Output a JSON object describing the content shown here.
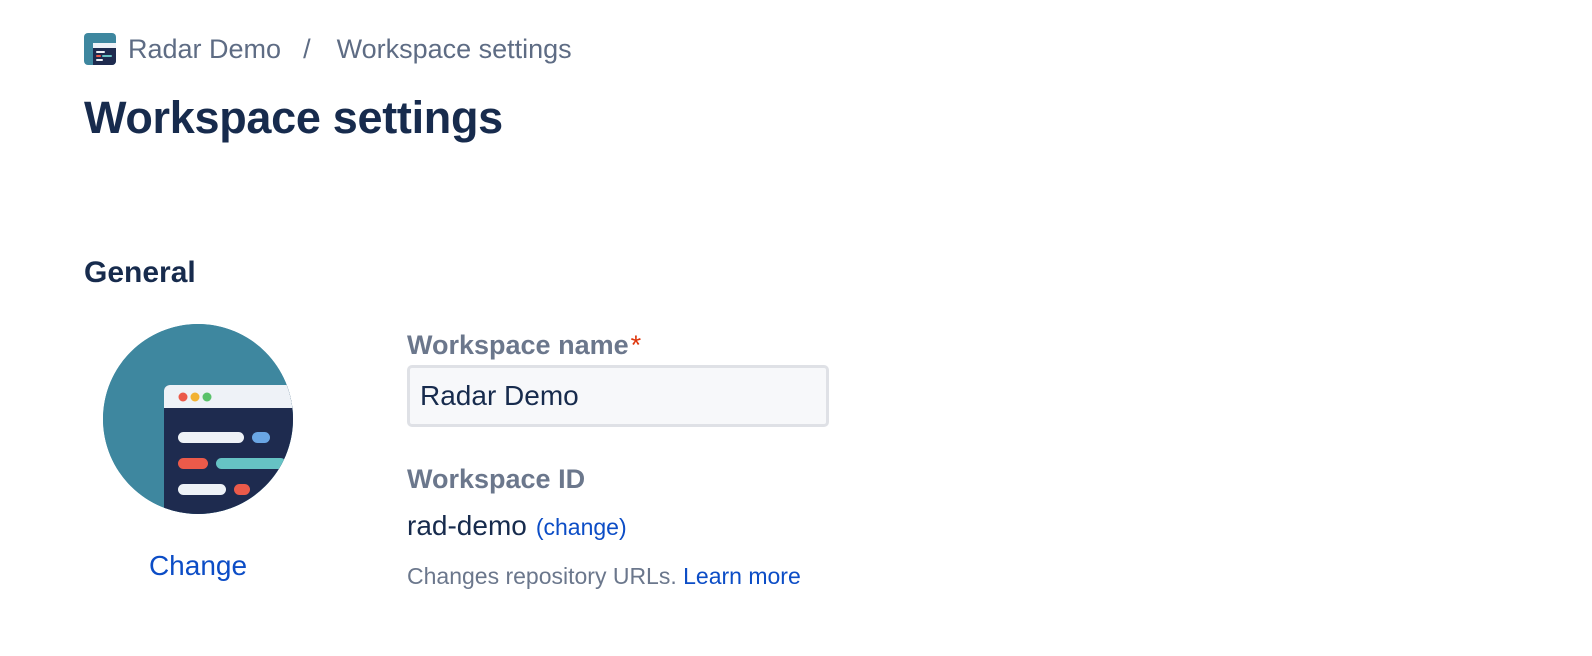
{
  "breadcrumb": {
    "workspace": "Radar Demo",
    "separator": "/",
    "current": "Workspace settings"
  },
  "page": {
    "title": "Workspace settings"
  },
  "general": {
    "heading": "General",
    "avatar_change_label": "Change"
  },
  "form": {
    "name_label": "Workspace name",
    "name_required_marker": "*",
    "name_value": "Radar Demo",
    "id_label": "Workspace ID",
    "id_value": "rad-demo",
    "id_change_label": "(change)",
    "helper_text": "Changes repository URLs.",
    "learn_more_label": "Learn more"
  },
  "colors": {
    "avatar_bg": "#3e879f",
    "text_primary": "#172b4d",
    "text_secondary": "#6b778c",
    "link": "#0c4dc6",
    "required": "#de350b"
  }
}
